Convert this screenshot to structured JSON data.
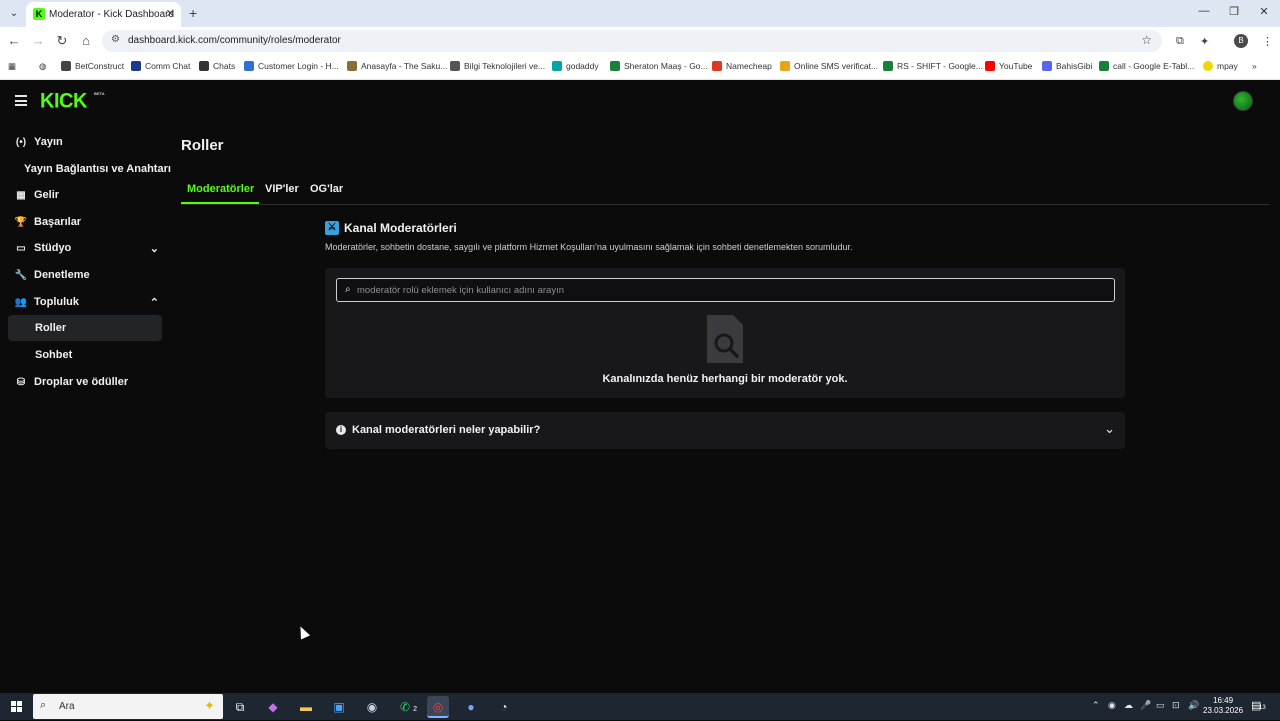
{
  "browser": {
    "tab_title": "Moderator - Kick Dashboard",
    "tab_favicon": "K",
    "new_tab": "+",
    "url": "dashboard.kick.com/community/roles/moderator",
    "profile_initial": "B",
    "window_controls": [
      "—",
      "❐",
      "✕"
    ]
  },
  "bookmarks": [
    {
      "label": "BetConstruct",
      "color": "#444444"
    },
    {
      "label": "Comm Chat",
      "color": "#1a3a8a"
    },
    {
      "label": "Chats",
      "color": "#333333"
    },
    {
      "label": "Customer Login - H...",
      "color": "#2f6fd6"
    },
    {
      "label": "Anasayfa - The Saku...",
      "color": "#8a6d3b"
    },
    {
      "label": "Bilgi Teknolojileri ve...",
      "color": "#555555"
    },
    {
      "label": "godaddy",
      "color": "#00a4a6"
    },
    {
      "label": "Sheraton Maaş - Go...",
      "color": "#188038"
    },
    {
      "label": "Namecheap",
      "color": "#de3723"
    },
    {
      "label": "Online SMS verificat...",
      "color": "#e8a317"
    },
    {
      "label": "RS - SHIFT - Google...",
      "color": "#188038"
    },
    {
      "label": "YouTube",
      "color": "#ff0000"
    },
    {
      "label": "BahisGibi",
      "color": "#5865f2"
    },
    {
      "label": "call - Google E-Tabl...",
      "color": "#188038"
    },
    {
      "label": "mpay",
      "color": "#f2d600"
    }
  ],
  "app": {
    "logo": "KICK",
    "logo_badge": "BETA"
  },
  "sidebar": {
    "items": [
      {
        "label": "Yayın",
        "icon": "(•)"
      },
      {
        "label": "Yayın Bağlantısı ve Anahtarı",
        "icon": ""
      },
      {
        "label": "Gelir",
        "icon": "▦"
      },
      {
        "label": "Başarılar",
        "icon": "🏆"
      },
      {
        "label": "Stüdyo",
        "icon": "▭"
      },
      {
        "label": "Denetleme",
        "icon": "🔧"
      },
      {
        "label": "Topluluk",
        "icon": "👥"
      },
      {
        "label": "Roller",
        "icon": ""
      },
      {
        "label": "Sohbet",
        "icon": ""
      },
      {
        "label": "Droplar ve ödüller",
        "icon": "⛁"
      }
    ]
  },
  "main": {
    "title": "Roller",
    "tabs": [
      "Moderatörler",
      "VIP'ler",
      "OG'lar"
    ],
    "section_title": "Kanal Moderatörleri",
    "section_description": "Moderatörler, sohbetin dostane, saygılı ve platform Hizmet Koşulları'na uyulmasını sağlamak için sohbeti denetlemekten sorumludur.",
    "search_placeholder": "moderatör rolü eklemek için kullanıcı adını arayın",
    "empty_message": "Kanalınızda henüz herhangi bir moderatör yok.",
    "faq_title": "Kanal moderatörleri neler yapabilir?"
  },
  "taskbar": {
    "search_label": "Ara",
    "whatsapp_badge": "2",
    "time": "16:49",
    "date": "23.03.2026",
    "notification_count": "13"
  },
  "colors": {
    "accent": "#53fc18",
    "background": "#0b0b0c",
    "panel": "#18181b"
  }
}
